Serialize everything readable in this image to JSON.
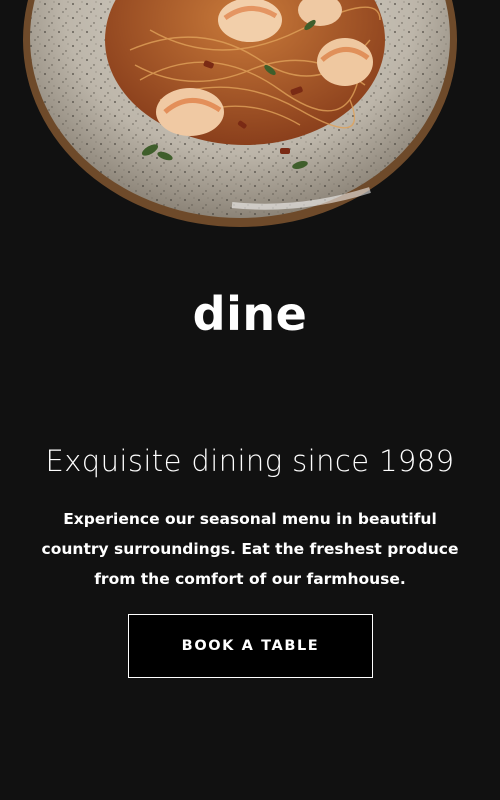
{
  "hero": {
    "image_alt": "Plate of shrimp spaghetti"
  },
  "brand": {
    "logo_text": "dine"
  },
  "intro": {
    "headline": "Exquisite dining since 1989",
    "description": "Experience our seasonal menu in beautiful country surroundings. Eat the freshest produce from the comfort of our farmhouse.",
    "cta_label": "BOOK A TABLE"
  },
  "colors": {
    "background": "#111111",
    "button_background": "#000000",
    "text": "#ffffff"
  }
}
